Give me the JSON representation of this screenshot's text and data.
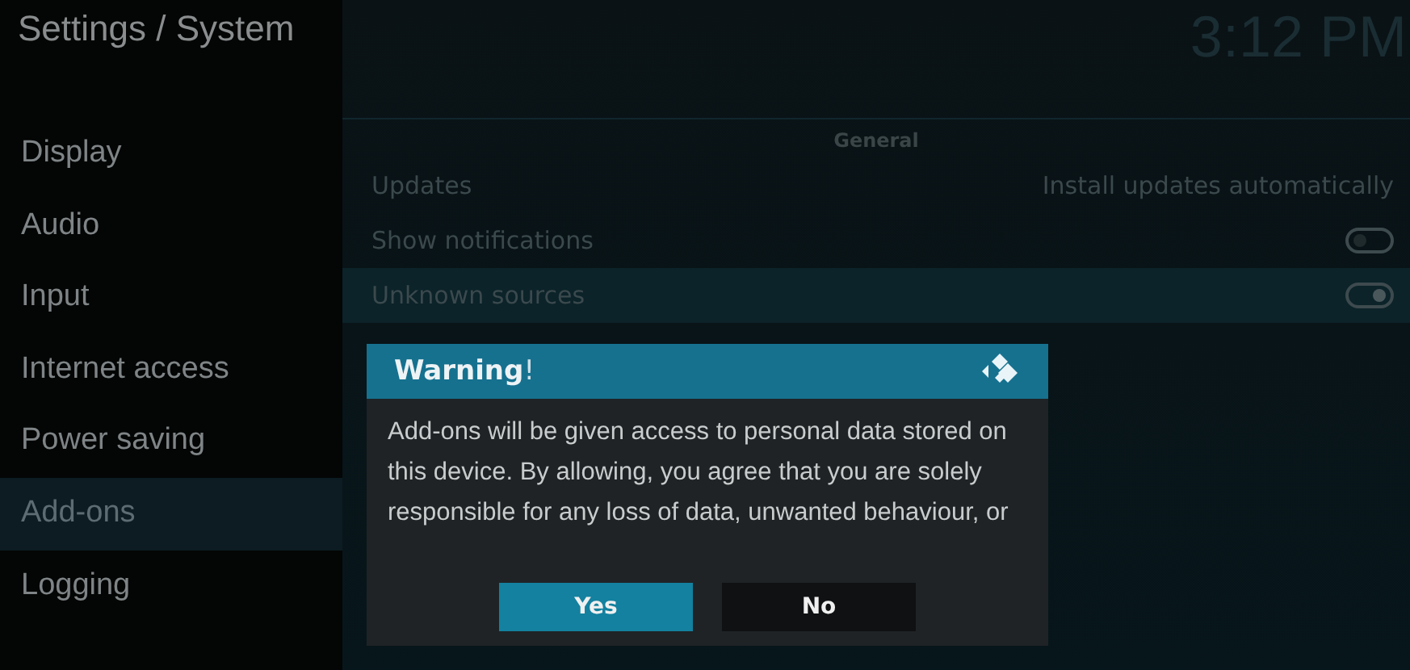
{
  "header": {
    "title": "Settings / System",
    "clock": "3:12 PM"
  },
  "sidebar": {
    "items": [
      {
        "label": "Display",
        "selected": false
      },
      {
        "label": "Audio",
        "selected": false
      },
      {
        "label": "Input",
        "selected": false
      },
      {
        "label": "Internet access",
        "selected": false
      },
      {
        "label": "Power saving",
        "selected": false
      },
      {
        "label": "Add-ons",
        "selected": true
      },
      {
        "label": "Logging",
        "selected": false
      }
    ]
  },
  "section": {
    "title": "General",
    "settings": [
      {
        "kind": "value",
        "label": "Updates",
        "value": "Install updates automatically",
        "selected": false
      },
      {
        "kind": "toggle",
        "label": "Show notifications",
        "on": false,
        "selected": false
      },
      {
        "kind": "toggle",
        "label": "Unknown sources",
        "on": true,
        "selected": true
      }
    ]
  },
  "dialog": {
    "title": "Warning",
    "title_mark": "!",
    "body": "Add-ons will be given access to personal data stored on this device. By allowing, you agree that you are solely responsible for any loss of data, unwanted behaviour, or",
    "buttons": [
      {
        "label": "Yes",
        "selected": true
      },
      {
        "label": "No",
        "selected": false
      }
    ]
  }
}
